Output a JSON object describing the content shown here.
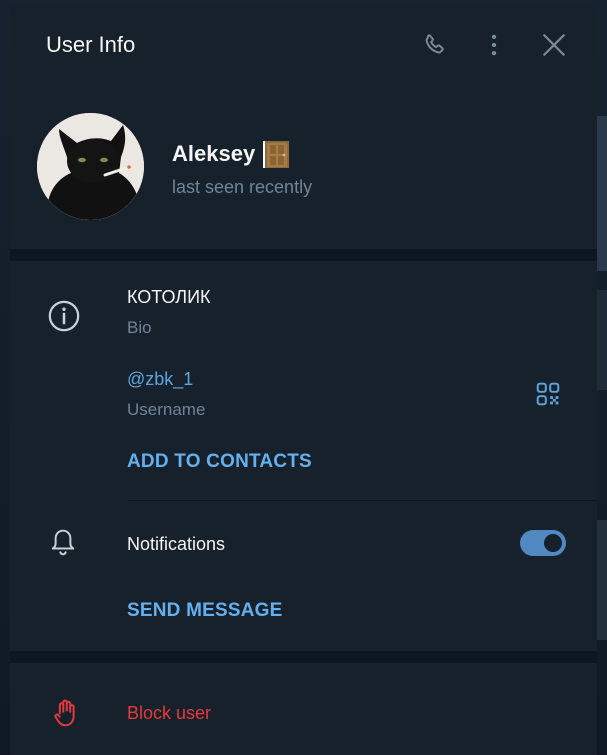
{
  "header": {
    "title": "User Info",
    "call_icon": "phone-icon",
    "more_icon": "more-vertical-icon",
    "close_icon": "close-icon"
  },
  "profile": {
    "name": "Aleksey",
    "status": "last seen recently"
  },
  "info": {
    "bio_value": "КОТОЛИК",
    "bio_label": "Bio",
    "username_value": "@zbk_1",
    "username_label": "Username",
    "add_contacts": "ADD TO CONTACTS"
  },
  "notifications": {
    "label": "Notifications",
    "enabled": true
  },
  "send_message": "SEND MESSAGE",
  "block_user": "Block user",
  "colors": {
    "accent": "#5ea5e0",
    "toggle": "#5288c1",
    "danger": "#e53a3d",
    "secondary_text": "#708499",
    "panel": "#17212b"
  }
}
